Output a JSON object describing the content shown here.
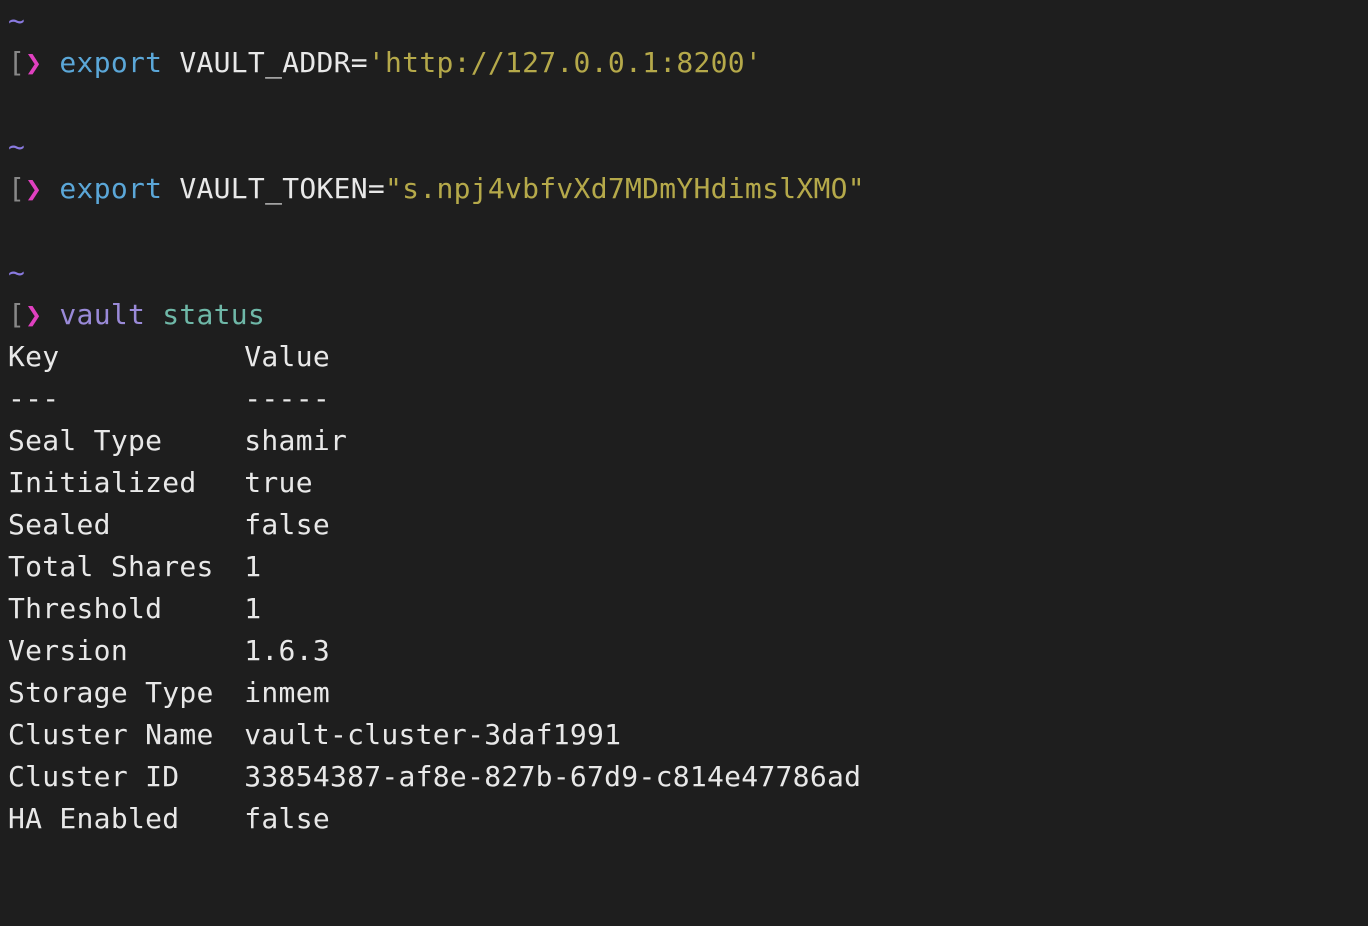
{
  "tilde": "~",
  "bracket": "[",
  "arrow": "❯",
  "cmd1": {
    "keyword": "export",
    "rest": " VAULT_ADDR=",
    "string": "'http://127.0.0.1:8200'"
  },
  "cmd2": {
    "keyword": "export",
    "rest": " VAULT_TOKEN=",
    "string": "\"s.npj4vbfvXd7MDmYHdimslXMO\""
  },
  "cmd3": {
    "name": "vault",
    "arg": "status"
  },
  "output": {
    "header_key": "Key",
    "header_value": "Value",
    "divider_key": "---",
    "divider_value": "-----",
    "rows": [
      {
        "key": "Seal Type",
        "value": "shamir"
      },
      {
        "key": "Initialized",
        "value": "true"
      },
      {
        "key": "Sealed",
        "value": "false"
      },
      {
        "key": "Total Shares",
        "value": "1"
      },
      {
        "key": "Threshold",
        "value": "1"
      },
      {
        "key": "Version",
        "value": "1.6.3"
      },
      {
        "key": "Storage Type",
        "value": "inmem"
      },
      {
        "key": "Cluster Name",
        "value": "vault-cluster-3daf1991"
      },
      {
        "key": "Cluster ID",
        "value": "33854387-af8e-827b-67d9-c814e47786ad"
      },
      {
        "key": "HA Enabled",
        "value": "false"
      }
    ]
  }
}
